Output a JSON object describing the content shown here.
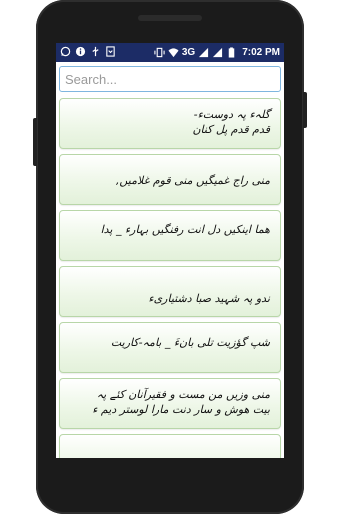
{
  "status_bar": {
    "network": "3G",
    "time": "7:02 PM",
    "left_icons": [
      "whatsapp-icon",
      "info-icon",
      "usb-icon",
      "download-icon"
    ],
    "right_icons": [
      "vibrate-icon",
      "wifi-icon",
      "signal-icon",
      "signal-icon",
      "battery-icon"
    ]
  },
  "search": {
    "placeholder": "Search..."
  },
  "poems": [
    {
      "text": "گلہء پہ دوستء-\nقدم قدم پل کنان"
    },
    {
      "text": "منی راج غمیگیں منی قوم غلامیں,"
    },
    {
      "text": "هما اینکیں دل انت رفنگیں بہارء _ پدا"
    },
    {
      "text": "ندو پہ شہید صبا دشتیاریء"
    },
    {
      "text": "شپ گؤزیت تلی بانءَ _ بامہ-کاریت"
    },
    {
      "text": "منی وزیں من مست و فقیرآنان کئے پہ\nبیت هوش و سار دنت مارا لوستر دیم ء"
    },
    {
      "text": ""
    }
  ],
  "colors": {
    "status_bar": "#1c2c66",
    "search_border": "#7fb6df",
    "card_border": "#b8d6a8",
    "card_fill": "#eef7e8"
  }
}
